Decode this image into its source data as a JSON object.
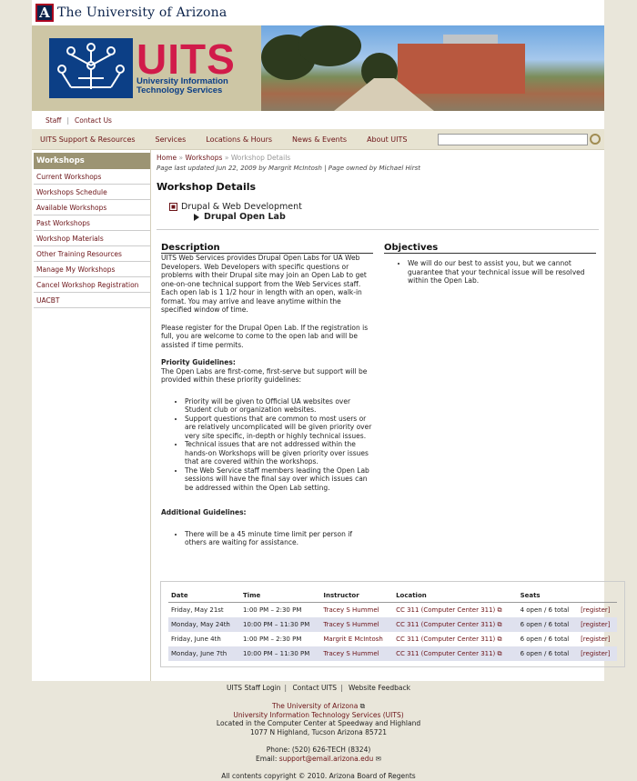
{
  "header": {
    "university_name": "The University of Arizona",
    "ua_letter": "A",
    "uits_logo_text": "UITS",
    "uits_line1": "University Information",
    "uits_line2": "Technology Services"
  },
  "utility_links": [
    "Staff",
    "Contact Us"
  ],
  "nav": {
    "items": [
      "UITS Support & Resources",
      "Services",
      "Locations & Hours",
      "News & Events",
      "About UITS"
    ],
    "search_value": ""
  },
  "sidebar": {
    "title": "Workshops",
    "items": [
      "Current Workshops",
      "Workshops Schedule",
      "Available Workshops",
      "Past Workshops",
      "Workshop Materials",
      "Other Training Resources",
      "Manage My Workshops",
      "Cancel Workshop Registration",
      "UACBT"
    ]
  },
  "breadcrumb": {
    "home": "Home",
    "sep": "»",
    "workshops": "Workshops",
    "current": "Workshop Details"
  },
  "updated": "Page last updated Jun 22, 2009 by Margrit McIntosh  |  Page owned by Michael Hirst",
  "page_title": "Workshop Details",
  "category": "Drupal & Web Development",
  "subcategory": "Drupal Open Lab",
  "description": {
    "heading": "Description",
    "p1": "UITS Web Services provides Drupal Open Labs for UA Web Developers. Web Developers with specific questions or problems with their Drupal site may join an Open Lab to get one-on-one technical support from the Web Services staff. Each open lab is 1 1/2 hour in length with an open, walk-in format. You may arrive and leave anytime within the specified window of time.",
    "p2": "Please register for the Drupal Open Lab. If the registration is full, you are welcome to come to the open lab and will be assisted if time permits.",
    "priority_heading": "Priority Guidelines:",
    "priority_intro": "The Open Labs are first-come, first-serve but support will be provided within these priority guidelines:",
    "priority_items": [
      "Priority will be given to Official UA websites over Student club or organization websites.",
      "Support questions that are common to most users or are relatively uncomplicated will be given priority over very site specific, in-depth or highly technical issues.",
      "Technical issues that are not addressed within the hands-on Workshops will be given priority over issues that are covered within the workshops.",
      "The Web Service staff members leading the Open Lab sessions will have the final say over which issues can be addressed within the Open Lab setting."
    ],
    "additional_heading": "Additional Guidelines:",
    "additional_items": [
      "There will be a 45 minute time limit per person if others are waiting for assistance."
    ]
  },
  "objectives": {
    "heading": "Objectives",
    "items": [
      "We will do our best to assist you, but we cannot guarantee that your technical issue will be resolved within the Open Lab."
    ]
  },
  "schedule": {
    "headers": [
      "Date",
      "Time",
      "Instructor",
      "Location",
      "Seats",
      ""
    ],
    "rows": [
      {
        "date": "Friday, May 21st",
        "time": "1:00 PM – 2:30 PM",
        "instructor": "Tracey S Hummel",
        "location": "CC 311 (Computer Center 311)",
        "seats": "4 open / 6 total",
        "action": "[register]"
      },
      {
        "date": "Monday, May 24th",
        "time": "10:00 PM – 11:30 PM",
        "instructor": "Tracey S Hummel",
        "location": "CC 311 (Computer Center 311)",
        "seats": "6 open / 6 total",
        "action": "[register]"
      },
      {
        "date": "Friday, June 4th",
        "time": "1:00 PM – 2:30 PM",
        "instructor": "Margrit E McIntosh",
        "location": "CC 311 (Computer Center 311)",
        "seats": "6 open / 6 total",
        "action": "[register]"
      },
      {
        "date": "Monday, June 7th",
        "time": "10:00 PM – 11:30 PM",
        "instructor": "Tracey S Hummel",
        "location": "CC 311 (Computer Center 311)",
        "seats": "6 open / 6 total",
        "action": "[register]"
      }
    ]
  },
  "footer": {
    "links": [
      "UITS Staff Login",
      "Contact UITS",
      "Website Feedback"
    ],
    "ua": "The University of Arizona",
    "uits": "University Information Technology Services (UITS)",
    "location": "Located in the Computer Center at Speedway and Highland",
    "address": "1077 N Highland, Tucson Arizona 85721",
    "phone": "Phone: (520) 626-TECH (8324)",
    "email_label": "Email:",
    "email": "support@email.arizona.edu",
    "copyright": "All contents copyright © 2010. Arizona Board of Regents"
  }
}
